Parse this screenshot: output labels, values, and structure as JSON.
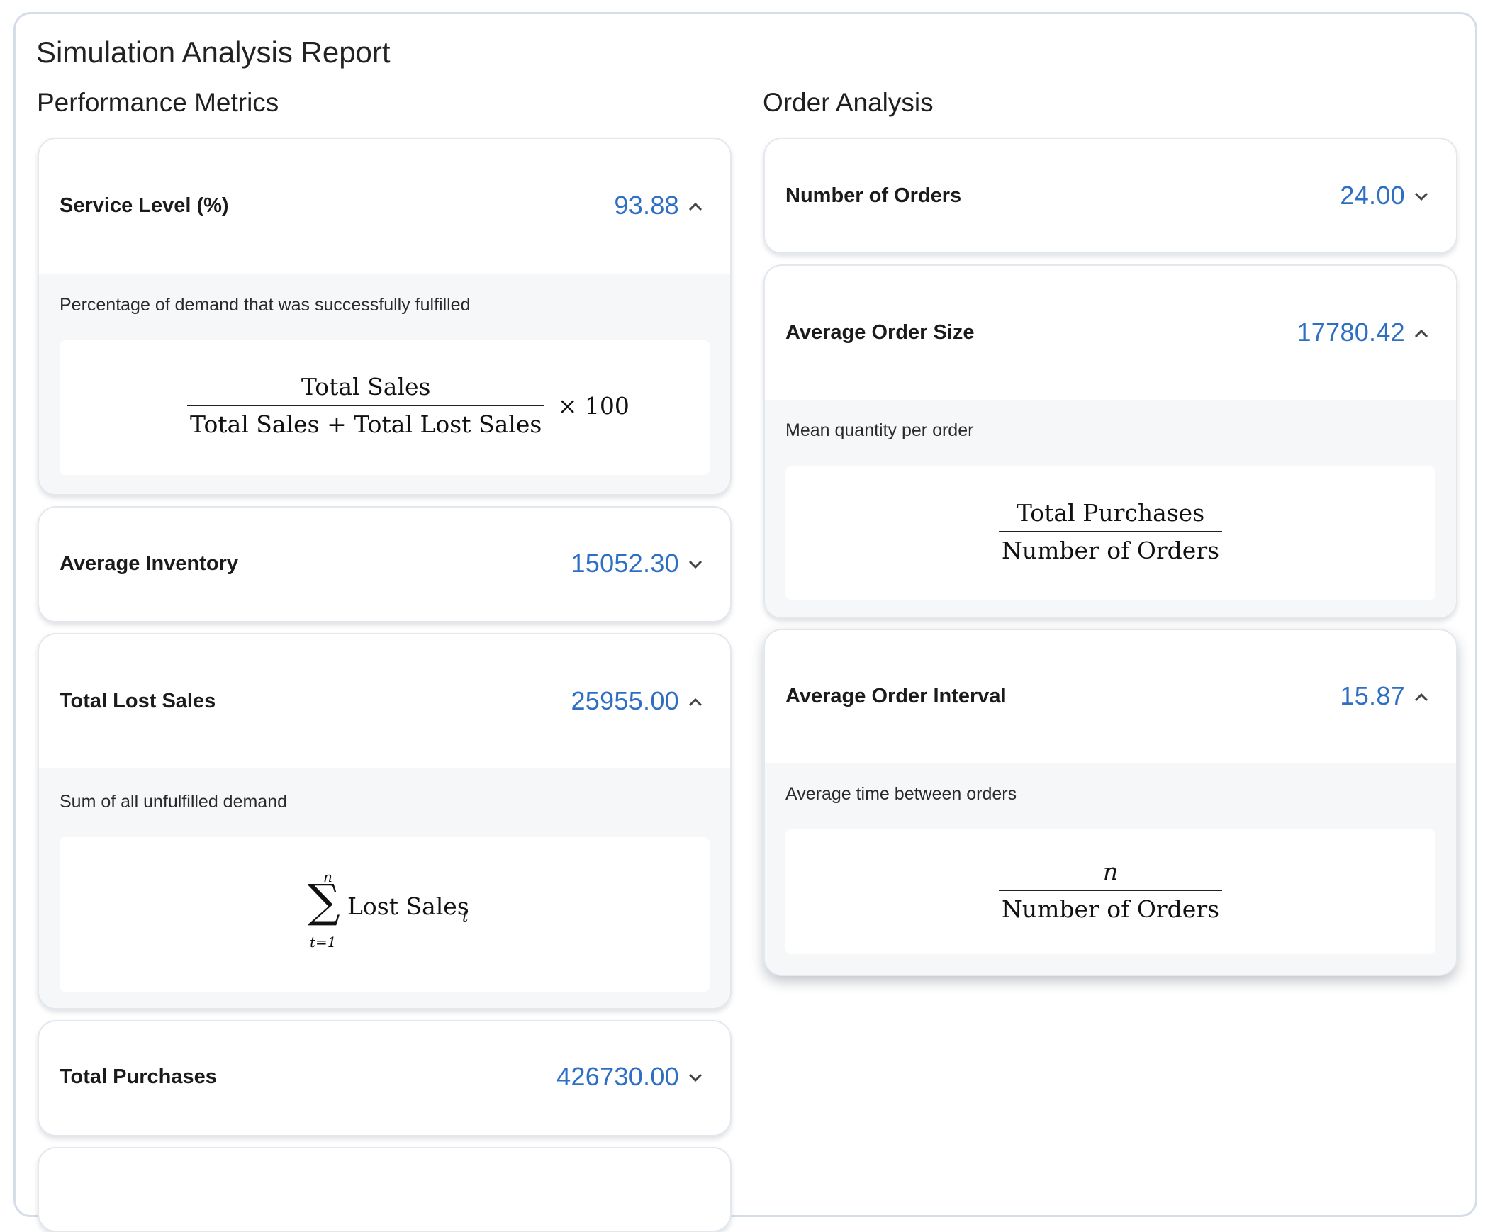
{
  "report": {
    "title": "Simulation Analysis Report"
  },
  "sections": {
    "performance": {
      "heading": "Performance Metrics"
    },
    "orders": {
      "heading": "Order Analysis"
    }
  },
  "colors": {
    "value": "#2e6fc4",
    "body_bg": "#f6f7f9",
    "card_border": "#e3e8ef"
  },
  "performance_metrics": {
    "service_level": {
      "label": "Service Level (%)",
      "value": "93.88",
      "expanded": true,
      "chevron": "chevron-up-icon",
      "description": "Percentage of demand that was successfully fulfilled",
      "formula": {
        "numerator": "Total Sales",
        "denominator": "Total Sales + Total Lost Sales",
        "multiplier": "× 100"
      }
    },
    "average_inventory": {
      "label": "Average Inventory",
      "value": "15052.30",
      "expanded": false,
      "chevron": "chevron-down-icon"
    },
    "total_lost_sales": {
      "label": "Total Lost Sales",
      "value": "25955.00",
      "expanded": true,
      "chevron": "chevron-up-icon",
      "description": "Sum of all unfulfilled demand",
      "formula": {
        "upper": "n",
        "lower": "t=1",
        "term": "Lost Sales",
        "subscript": "t"
      }
    },
    "total_purchases": {
      "label": "Total Purchases",
      "value": "426730.00",
      "expanded": false,
      "chevron": "chevron-down-icon"
    }
  },
  "order_analysis": {
    "number_of_orders": {
      "label": "Number of Orders",
      "value": "24.00",
      "expanded": false,
      "chevron": "chevron-down-icon"
    },
    "average_order_size": {
      "label": "Average Order Size",
      "value": "17780.42",
      "expanded": true,
      "chevron": "chevron-up-icon",
      "description": "Mean quantity per order",
      "formula": {
        "numerator": "Total Purchases",
        "denominator": "Number of Orders"
      }
    },
    "average_order_interval": {
      "label": "Average Order Interval",
      "value": "15.87",
      "expanded": true,
      "chevron": "chevron-up-icon",
      "description": "Average time between orders",
      "formula": {
        "numerator": "n",
        "denominator": "Number of Orders"
      }
    }
  }
}
